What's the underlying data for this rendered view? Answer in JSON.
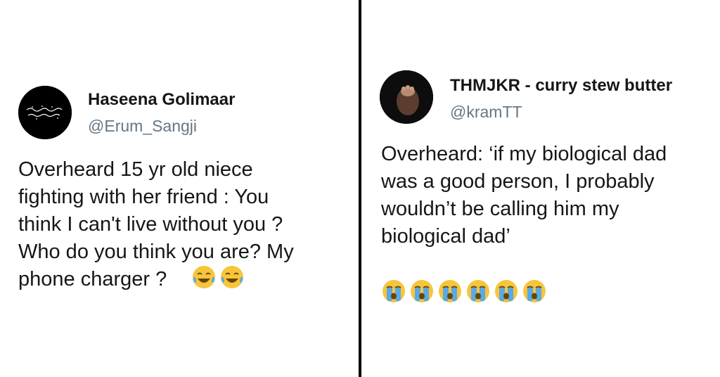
{
  "left_tweet": {
    "display_name": "Haseena Golimaar",
    "handle": "@Erum_Sangji",
    "text": "Overheard 15 yr old niece\nfighting with her friend : You\nthink I can't live without you ?\nWho do you think you are?  My\nphone charger ?",
    "emojis": [
      "face-with-tears-of-joy-icon",
      "face-with-tears-of-joy-icon"
    ]
  },
  "right_tweet": {
    "display_name": "THMJKR - curry stew butter",
    "handle": "@kramTT",
    "text": "Overheard: ‘if my biological dad\nwas a good person, I probably\nwouldn’t be calling him my\nbiological dad’",
    "emojis": [
      "loudly-crying-face-icon",
      "loudly-crying-face-icon",
      "loudly-crying-face-icon",
      "loudly-crying-face-icon",
      "loudly-crying-face-icon",
      "loudly-crying-face-icon"
    ]
  },
  "colors": {
    "text": "#14171a",
    "handle": "#657786",
    "divider": "#000000",
    "emoji_yellow": "#f7c53c",
    "tear_blue": "#5aa9e6"
  }
}
